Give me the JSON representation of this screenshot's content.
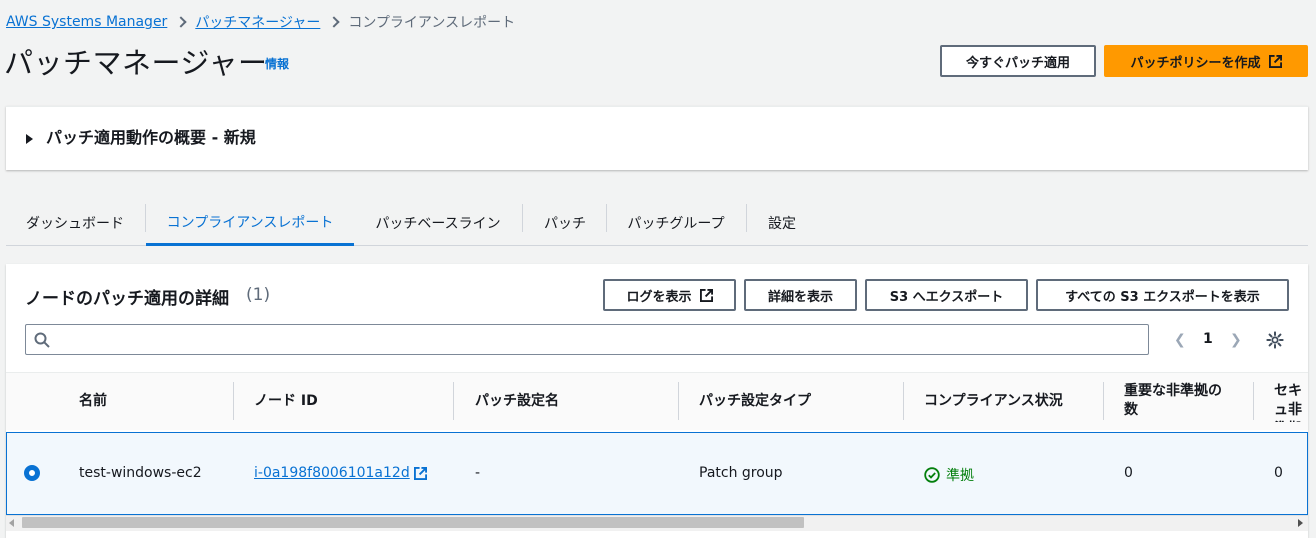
{
  "breadcrumb": {
    "items": [
      "AWS Systems Manager",
      "パッチマネージャー"
    ],
    "current": "コンプライアンスレポート"
  },
  "header": {
    "title": "パッチマネージャー",
    "info": "情報",
    "patch_now_label": "今すぐパッチ適用",
    "create_policy_label": "パッチポリシーを作成"
  },
  "overview": {
    "title": "パッチ適用動作の概要 - 新規"
  },
  "tabs": [
    {
      "label": "ダッシュボード"
    },
    {
      "label": "コンプライアンスレポート",
      "active": true
    },
    {
      "label": "パッチベースライン"
    },
    {
      "label": "パッチ"
    },
    {
      "label": "パッチグループ"
    },
    {
      "label": "設定"
    }
  ],
  "table": {
    "title": "ノードのパッチ適用の詳細",
    "count": "(1)",
    "actions": {
      "view_logs": "ログを表示",
      "view_details": "詳細を表示",
      "export_s3": "S3 へエクスポート",
      "view_all_exports": "すべての S3 エクスポートを表示"
    },
    "search_placeholder": "",
    "page": "1",
    "columns": [
      "名前",
      "ノード ID",
      "パッチ設定名",
      "パッチ設定タイプ",
      "コンプライアンス状況",
      "重要な非準拠の数",
      "セキュ非準拠"
    ],
    "rows": [
      {
        "name": "test-windows-ec2",
        "node_id": "i-0a198f8006101a12d",
        "patch_config_name": "-",
        "patch_config_type": "Patch group",
        "compliance": "準拠",
        "critical_noncompliant": "0",
        "security_noncompliant": "0"
      }
    ]
  },
  "colors": {
    "accent": "#0972d3",
    "primary_button": "#ff9900",
    "compliant": "#037f0c"
  },
  "icons": [
    "external-link-icon",
    "search-icon",
    "chevron-left-icon",
    "chevron-right-icon",
    "gear-icon",
    "check-circle-icon",
    "caret-right-icon"
  ]
}
